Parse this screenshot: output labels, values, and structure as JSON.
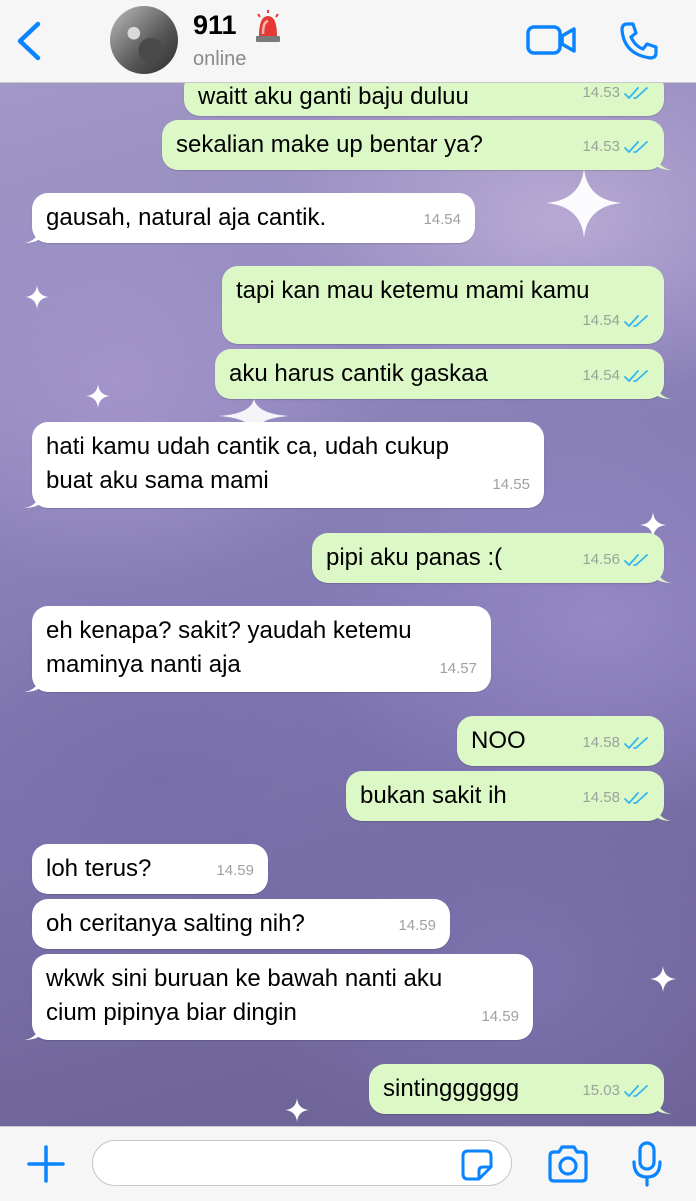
{
  "header": {
    "contact_name": "911",
    "contact_status": "online"
  },
  "messages": [
    {
      "direction": "out",
      "text": "waitt aku ganti baju duluu",
      "time": "14.53",
      "read": true
    },
    {
      "direction": "out",
      "text": "sekalian make up bentar ya?",
      "time": "14.53",
      "read": true
    },
    {
      "direction": "in",
      "text": "gausah, natural aja cantik.",
      "time": "14.54"
    },
    {
      "direction": "out",
      "text": "tapi kan mau ketemu mami kamu",
      "time": "14.54",
      "read": true
    },
    {
      "direction": "out",
      "text": "aku harus cantik gaskaa",
      "time": "14.54",
      "read": true
    },
    {
      "direction": "in",
      "lines": [
        "hati kamu udah cantik ca, udah cukup",
        "buat aku sama mami"
      ],
      "time": "14.55"
    },
    {
      "direction": "out",
      "text": "pipi aku panas :(",
      "time": "14.56",
      "read": true
    },
    {
      "direction": "in",
      "lines": [
        "eh kenapa? sakit? yaudah ketemu",
        "maminya nanti aja"
      ],
      "time": "14.57"
    },
    {
      "direction": "out",
      "text": "NOO",
      "time": "14.58",
      "read": true
    },
    {
      "direction": "out",
      "text": "bukan sakit ih",
      "time": "14.58",
      "read": true
    },
    {
      "direction": "in",
      "text": "loh terus?",
      "time": "14.59"
    },
    {
      "direction": "in",
      "text": "oh ceritanya salting nih?",
      "time": "14.59"
    },
    {
      "direction": "in",
      "lines": [
        "wkwk sini buruan ke bawah nanti aku",
        "cium pipinya biar dingin"
      ],
      "time": "14.59"
    },
    {
      "direction": "out",
      "text": "sintingggggg",
      "time": "15.03",
      "read": true
    }
  ],
  "composer": {
    "value": "",
    "placeholder": ""
  },
  "colors": {
    "accent": "#0a84ff",
    "outgoing_bubble": "#dcf8c6",
    "incoming_bubble": "#ffffff",
    "read_ticks": "#34b7f1"
  },
  "icons": {
    "back": "chevron-left-icon",
    "status_emoji": "siren-icon",
    "video": "video-camera-icon",
    "call": "phone-icon",
    "attach": "plus-icon",
    "sticker": "sticker-icon",
    "camera": "camera-icon",
    "mic": "microphone-icon"
  }
}
